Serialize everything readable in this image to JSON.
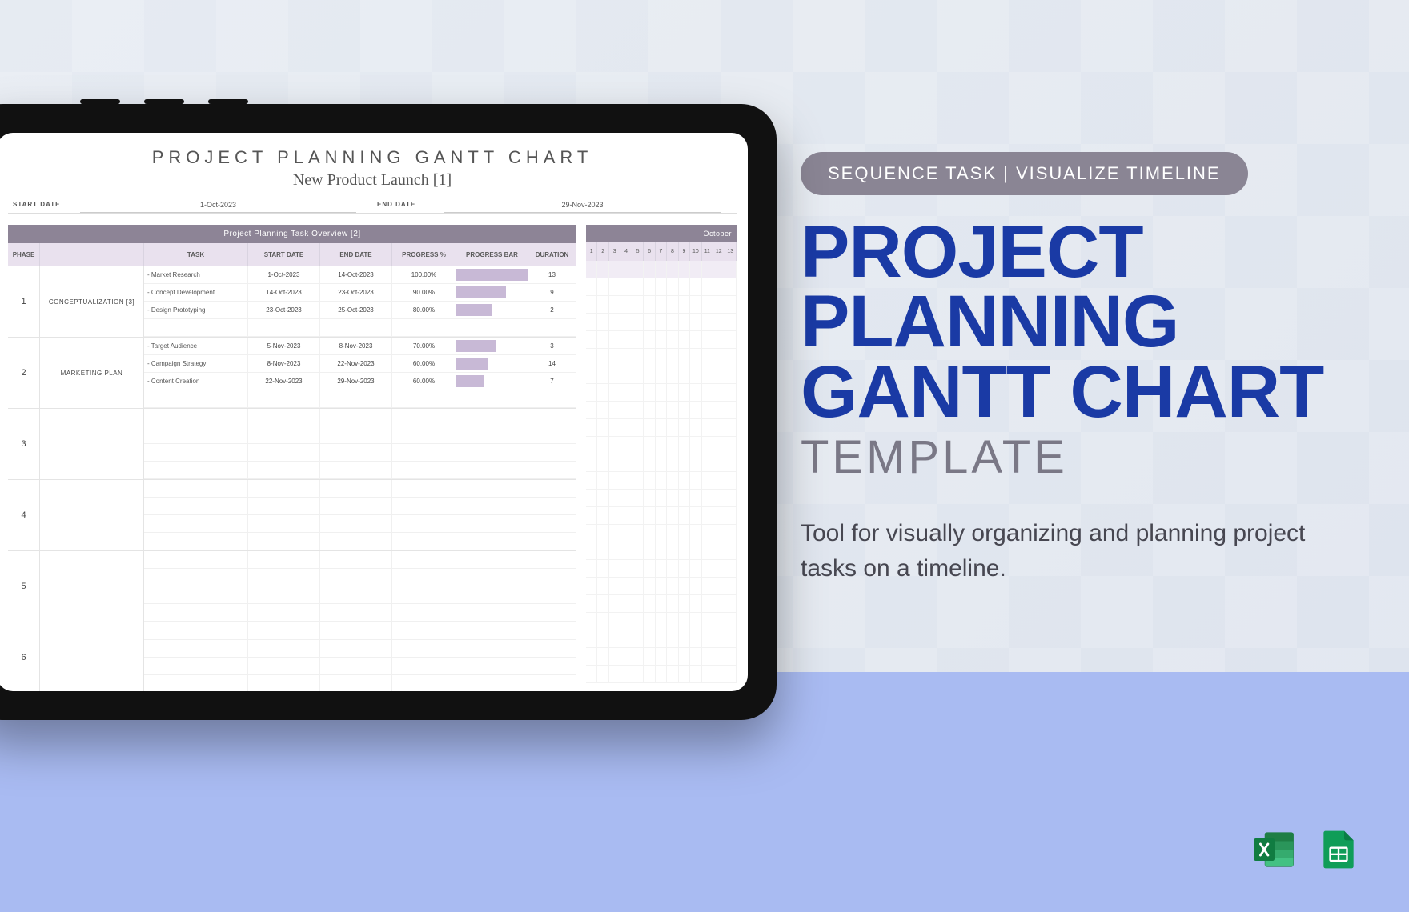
{
  "badge": "SEQUENCE TASK  |  VISUALIZE TIMELINE",
  "title": {
    "line1": "PROJECT",
    "line2": "PLANNING",
    "line3": "GANTT CHART",
    "sub": "TEMPLATE"
  },
  "description": "Tool for visually organizing and planning project tasks on a timeline.",
  "sheet": {
    "title": "PROJECT PLANNING GANTT CHART",
    "subtitle": "New Product Launch [1]",
    "start_label": "START DATE",
    "start_value": "1-Oct-2023",
    "end_label": "END DATE",
    "end_value": "29-Nov-2023",
    "overview_header": "Project Planning Task Overview [2]",
    "columns": [
      "PHASE",
      "",
      "TASK",
      "START DATE",
      "END DATE",
      "PROGRESS %",
      "PROGRESS BAR",
      "DURATION"
    ],
    "month_header": "October",
    "day_numbers": [
      "1",
      "2",
      "3",
      "4",
      "5",
      "6",
      "7",
      "8",
      "9",
      "10",
      "11",
      "12",
      "13"
    ],
    "phases": [
      {
        "num": "1",
        "name": "CONCEPTUALIZATION [3]",
        "tasks": [
          {
            "name": "- Market Research",
            "start": "1-Oct-2023",
            "end": "14-Oct-2023",
            "progress": "100.00%",
            "bar": 100,
            "duration": "13"
          },
          {
            "name": "- Concept Development",
            "start": "14-Oct-2023",
            "end": "23-Oct-2023",
            "progress": "90.00%",
            "bar": 70,
            "duration": "9"
          },
          {
            "name": "- Design Prototyping",
            "start": "23-Oct-2023",
            "end": "25-Oct-2023",
            "progress": "80.00%",
            "bar": 50,
            "duration": "2"
          }
        ]
      },
      {
        "num": "2",
        "name": "MARKETING PLAN",
        "tasks": [
          {
            "name": "- Target Audience",
            "start": "5-Nov-2023",
            "end": "8-Nov-2023",
            "progress": "70.00%",
            "bar": 55,
            "duration": "3"
          },
          {
            "name": "- Campaign Strategy",
            "start": "8-Nov-2023",
            "end": "22-Nov-2023",
            "progress": "60.00%",
            "bar": 45,
            "duration": "14"
          },
          {
            "name": "- Content Creation",
            "start": "22-Nov-2023",
            "end": "29-Nov-2023",
            "progress": "60.00%",
            "bar": 38,
            "duration": "7"
          }
        ]
      },
      {
        "num": "3",
        "name": "",
        "tasks": []
      },
      {
        "num": "4",
        "name": "",
        "tasks": []
      },
      {
        "num": "5",
        "name": "",
        "tasks": []
      },
      {
        "num": "6",
        "name": "",
        "tasks": []
      }
    ]
  },
  "chart_data": {
    "type": "bar",
    "title": "Project Planning Gantt Chart — New Product Launch",
    "xlabel": "Date",
    "ylabel": "Task",
    "series": [
      {
        "name": "Market Research",
        "start": "2023-10-01",
        "end": "2023-10-14",
        "progress_pct": 100,
        "duration_days": 13,
        "phase": "Conceptualization"
      },
      {
        "name": "Concept Development",
        "start": "2023-10-14",
        "end": "2023-10-23",
        "progress_pct": 90,
        "duration_days": 9,
        "phase": "Conceptualization"
      },
      {
        "name": "Design Prototyping",
        "start": "2023-10-23",
        "end": "2023-10-25",
        "progress_pct": 80,
        "duration_days": 2,
        "phase": "Conceptualization"
      },
      {
        "name": "Target Audience",
        "start": "2023-11-05",
        "end": "2023-11-08",
        "progress_pct": 70,
        "duration_days": 3,
        "phase": "Marketing Plan"
      },
      {
        "name": "Campaign Strategy",
        "start": "2023-11-08",
        "end": "2023-11-22",
        "progress_pct": 60,
        "duration_days": 14,
        "phase": "Marketing Plan"
      },
      {
        "name": "Content Creation",
        "start": "2023-11-22",
        "end": "2023-11-29",
        "progress_pct": 60,
        "duration_days": 7,
        "phase": "Marketing Plan"
      }
    ],
    "xlim": [
      "2023-10-01",
      "2023-11-29"
    ]
  }
}
